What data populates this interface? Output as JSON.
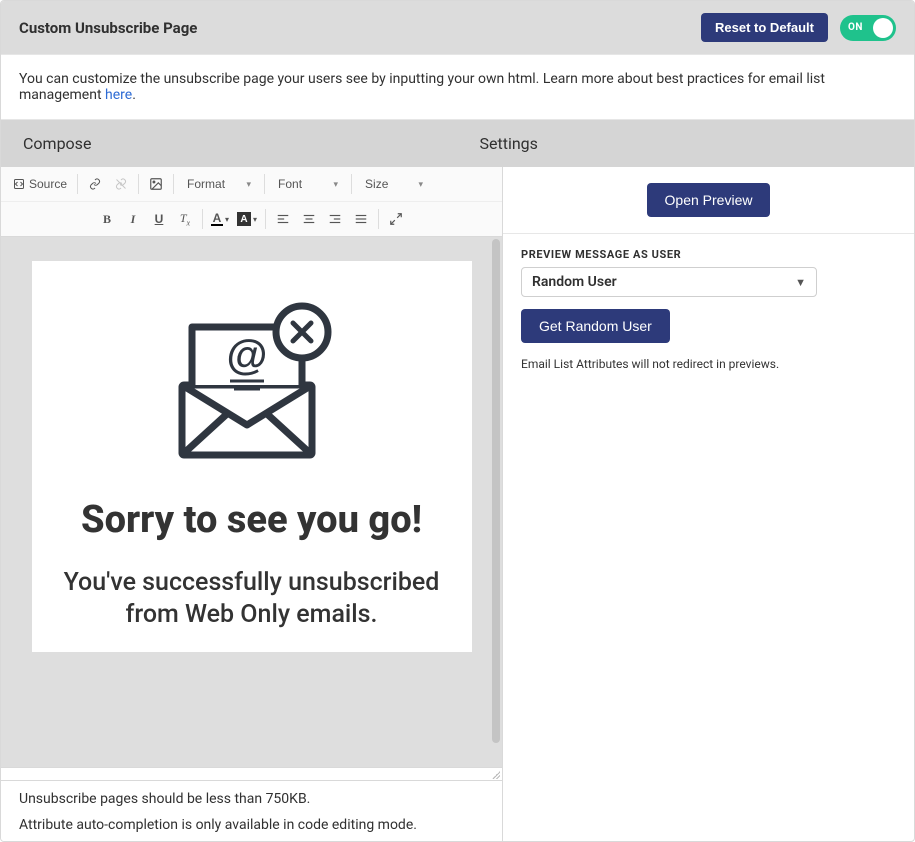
{
  "header": {
    "title": "Custom Unsubscribe Page",
    "reset_label": "Reset to Default",
    "toggle_label": "ON"
  },
  "info": {
    "text_before": "You can customize the unsubscribe page your users see by inputting your own html. Learn more about best practices for email list management ",
    "link_text": "here",
    "text_after": "."
  },
  "tabs": {
    "compose": "Compose",
    "settings": "Settings"
  },
  "toolbar": {
    "source": "Source",
    "format": "Format",
    "font": "Font",
    "size": "Size"
  },
  "canvas": {
    "heading": "Sorry to see you go!",
    "subtext": "You've successfully unsubscribed from Web Only emails."
  },
  "hints": {
    "size": "Unsubscribe pages should be less than 750KB.",
    "autocomplete": "Attribute auto-completion is only available in code editing mode."
  },
  "settings": {
    "preview_btn": "Open Preview",
    "user_label": "PREVIEW MESSAGE AS USER",
    "user_value": "Random User",
    "random_btn": "Get Random User",
    "note": "Email List Attributes will not redirect in previews."
  }
}
